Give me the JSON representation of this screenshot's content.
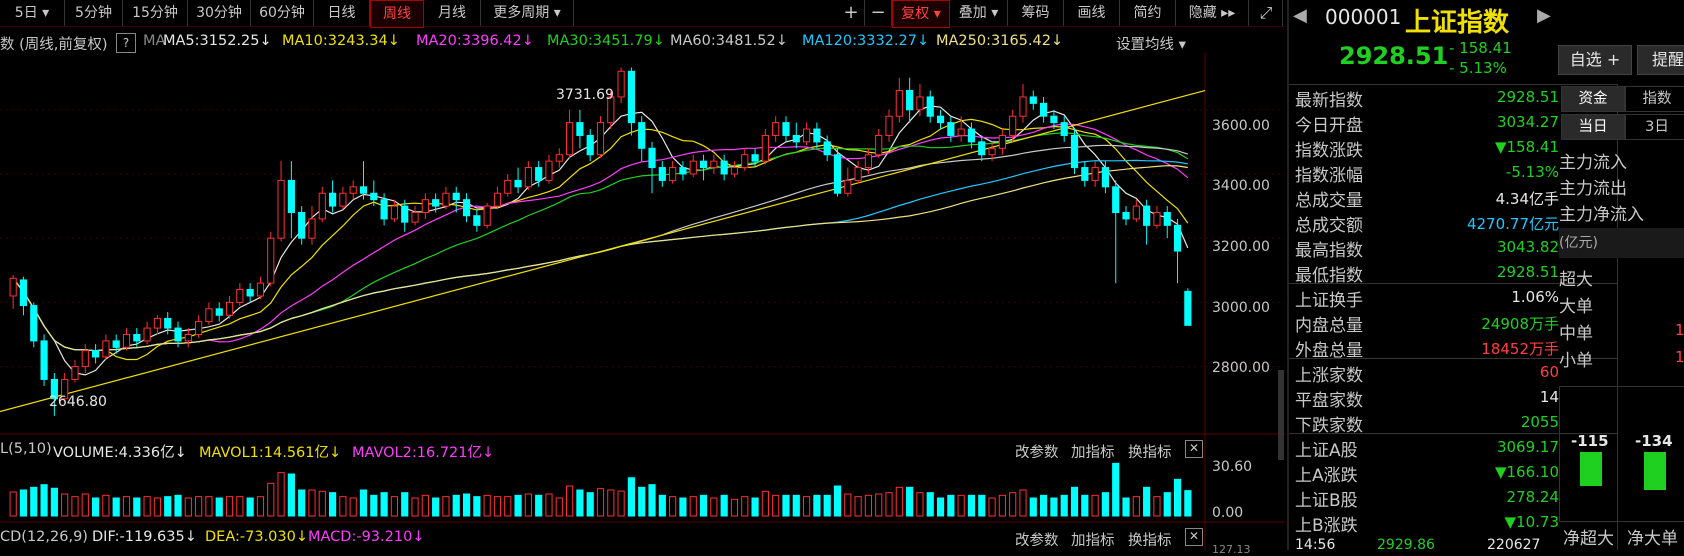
{
  "toolbar": {
    "periods": [
      "5日",
      "5分钟",
      "15分钟",
      "30分钟",
      "60分钟",
      "日线",
      "周线",
      "月线",
      "更多周期"
    ],
    "active_period": "周线",
    "right_buttons": [
      "+",
      "−",
      "复权",
      "叠加",
      "筹码",
      "画线",
      "简约",
      "隐藏"
    ]
  },
  "ma_legend": {
    "prefix": "数 (周线,前复权)",
    "help": "?",
    "ma_label": "MA",
    "items": [
      {
        "text": "MA5:3152.25",
        "color": "#e6e6e6"
      },
      {
        "text": "MA10:3243.34",
        "color": "#f0e000"
      },
      {
        "text": "MA20:3396.42",
        "color": "#ff3cff"
      },
      {
        "text": "MA30:3451.79",
        "color": "#20d020"
      },
      {
        "text": "MA60:3481.52",
        "color": "#c8c8c8"
      },
      {
        "text": "MA120:3332.27",
        "color": "#20c8ff"
      },
      {
        "text": "MA250:3165.42",
        "color": "#f0e080"
      }
    ],
    "settings": "设置均线"
  },
  "price_axis": [
    "3600.00",
    "3400.00",
    "3200.00",
    "3000.00",
    "2800.00"
  ],
  "annotations": {
    "high": "3731.69",
    "low": "2646.80"
  },
  "volume_header": {
    "prefix": "L(5,10)",
    "volume": "VOLUME:4.336亿",
    "mavol1": "MAVOL1:14.561亿",
    "mavol2": "MAVOL2:16.721亿",
    "buttons": [
      "改参数",
      "加指标",
      "换指标"
    ]
  },
  "volume_axis": [
    "30.60",
    "0.00"
  ],
  "macd_header": {
    "prefix": "CD(12,26,9)",
    "dif": "DIF:-119.635",
    "dea": "DEA:-73.030",
    "macd": "MACD:-93.210",
    "buttons": [
      "改参数",
      "加指标",
      "换指标"
    ],
    "axis_partial": "127.13"
  },
  "quote": {
    "code": "000001",
    "name": "上证指数",
    "price": "2928.51",
    "change": "- 158.41",
    "change_pct": "- 5.13%",
    "watch_button": "自选 +",
    "extra_button": "提醒",
    "rows": [
      {
        "label": "最新指数",
        "value": "2928.51",
        "color": "#20d020"
      },
      {
        "label": "今日开盘",
        "value": "3034.27",
        "color": "#20d020"
      },
      {
        "label": "指数涨跌",
        "value": "▼158.41",
        "color": "#20d020"
      },
      {
        "label": "指数涨幅",
        "value": "-5.13%",
        "color": "#20d020"
      },
      {
        "label": "总成交量",
        "value": "4.34亿手",
        "color": "#e6e6e6"
      },
      {
        "label": "总成交额",
        "value": "4270.77亿元",
        "color": "#20c8ff"
      },
      {
        "label": "最高指数",
        "value": "3043.82",
        "color": "#20d020"
      },
      {
        "label": "最低指数",
        "value": "2928.51",
        "color": "#20d020"
      },
      {
        "label": "上证换手",
        "value": "1.06%",
        "color": "#e6e6e6"
      },
      {
        "label": "内盘总量",
        "value": "24908万手",
        "color": "#20d020"
      },
      {
        "label": "外盘总量",
        "value": "18452万手",
        "color": "#ff4040"
      },
      {
        "label": "上涨家数",
        "value": "60",
        "color": "#ff4040"
      },
      {
        "label": "平盘家数",
        "value": "14",
        "color": "#e6e6e6"
      },
      {
        "label": "下跌家数",
        "value": "2055",
        "color": "#20d020"
      },
      {
        "label": "上证A股",
        "value": "3069.17",
        "color": "#20d020"
      },
      {
        "label": "上A涨跌",
        "value": "▼166.10",
        "color": "#20d020"
      },
      {
        "label": "上证B股",
        "value": "278.24",
        "color": "#20d020"
      },
      {
        "label": "上B涨跌",
        "value": "▼10.73",
        "color": "#20d020"
      }
    ],
    "bottom_row": {
      "time": "14:56",
      "price": "2929.86",
      "vol": "220627"
    }
  },
  "fund_panel": {
    "tabs1": [
      "资金",
      "指数"
    ],
    "tabs2": [
      "当日",
      "3日"
    ],
    "flows": [
      "主力流入",
      "主力流出",
      "主力净流入"
    ],
    "unit": "(亿元)",
    "sizes": [
      {
        "label": "超大",
        "value": ""
      },
      {
        "label": "大单",
        "value": ""
      },
      {
        "label": "中单",
        "value": "1"
      },
      {
        "label": "小单",
        "value": "1"
      }
    ],
    "bars": [
      {
        "label": "净超大",
        "value": "-115"
      },
      {
        "label": "净大单",
        "value": "-134"
      }
    ]
  },
  "chart_data": {
    "type": "candlestick",
    "note_series": [
      "MA5",
      "MA10",
      "MA20",
      "MA30",
      "MA60",
      "MA120",
      "MA250"
    ],
    "last_close": 2928.51,
    "high": 3731.69,
    "low": 2646.8,
    "ylim": [
      2590,
      3780
    ],
    "ticks": [
      3600,
      3400,
      3200,
      3000,
      2800
    ],
    "candles": [
      [
        3020,
        3075,
        2980,
        3085
      ],
      [
        3070,
        2990,
        2960,
        3080
      ],
      [
        2990,
        2880,
        2860,
        3000
      ],
      [
        2880,
        2760,
        2740,
        2900
      ],
      [
        2760,
        2700,
        2646.8,
        2780
      ],
      [
        2700,
        2760,
        2690,
        2780
      ],
      [
        2760,
        2800,
        2750,
        2820
      ],
      [
        2800,
        2850,
        2780,
        2870
      ],
      [
        2850,
        2830,
        2810,
        2870
      ],
      [
        2830,
        2880,
        2820,
        2900
      ],
      [
        2880,
        2860,
        2840,
        2900
      ],
      [
        2860,
        2900,
        2850,
        2920
      ],
      [
        2900,
        2880,
        2860,
        2920
      ],
      [
        2880,
        2920,
        2870,
        2940
      ],
      [
        2920,
        2950,
        2900,
        2960
      ],
      [
        2950,
        2920,
        2900,
        2970
      ],
      [
        2920,
        2880,
        2860,
        2940
      ],
      [
        2880,
        2900,
        2860,
        2920
      ],
      [
        2900,
        2940,
        2890,
        2960
      ],
      [
        2940,
        2980,
        2930,
        3000
      ],
      [
        2980,
        2960,
        2940,
        3000
      ],
      [
        2960,
        3000,
        2950,
        3020
      ],
      [
        3000,
        3040,
        2990,
        3060
      ],
      [
        3040,
        3020,
        3000,
        3060
      ],
      [
        3020,
        3060,
        3010,
        3080
      ],
      [
        3060,
        3200,
        3050,
        3220
      ],
      [
        3200,
        3380,
        3190,
        3440
      ],
      [
        3380,
        3280,
        3200,
        3440
      ],
      [
        3280,
        3200,
        3180,
        3300
      ],
      [
        3200,
        3260,
        3180,
        3300
      ],
      [
        3260,
        3340,
        3250,
        3360
      ],
      [
        3340,
        3300,
        3280,
        3380
      ],
      [
        3300,
        3340,
        3290,
        3360
      ],
      [
        3340,
        3360,
        3320,
        3380
      ],
      [
        3360,
        3340,
        3320,
        3440
      ],
      [
        3340,
        3320,
        3300,
        3380
      ],
      [
        3320,
        3260,
        3240,
        3340
      ],
      [
        3260,
        3300,
        3250,
        3320
      ],
      [
        3300,
        3250,
        3220,
        3320
      ],
      [
        3250,
        3280,
        3240,
        3300
      ],
      [
        3280,
        3320,
        3260,
        3340
      ],
      [
        3320,
        3300,
        3280,
        3340
      ],
      [
        3300,
        3340,
        3290,
        3360
      ],
      [
        3340,
        3320,
        3280,
        3360
      ],
      [
        3320,
        3270,
        3250,
        3340
      ],
      [
        3270,
        3240,
        3220,
        3290
      ],
      [
        3240,
        3300,
        3230,
        3310
      ],
      [
        3300,
        3340,
        3290,
        3360
      ],
      [
        3340,
        3380,
        3330,
        3400
      ],
      [
        3380,
        3360,
        3340,
        3420
      ],
      [
        3360,
        3420,
        3350,
        3440
      ],
      [
        3420,
        3380,
        3360,
        3440
      ],
      [
        3380,
        3440,
        3370,
        3460
      ],
      [
        3440,
        3460,
        3420,
        3480
      ],
      [
        3460,
        3560,
        3450,
        3600
      ],
      [
        3560,
        3520,
        3480,
        3600
      ],
      [
        3520,
        3460,
        3440,
        3540
      ],
      [
        3460,
        3560,
        3450,
        3580
      ],
      [
        3560,
        3640,
        3540,
        3660
      ],
      [
        3640,
        3720,
        3620,
        3731.69
      ],
      [
        3720,
        3560,
        3520,
        3731.69
      ],
      [
        3560,
        3480,
        3440,
        3580
      ],
      [
        3480,
        3420,
        3340,
        3500
      ],
      [
        3420,
        3380,
        3360,
        3440
      ],
      [
        3380,
        3420,
        3370,
        3440
      ],
      [
        3420,
        3400,
        3380,
        3440
      ],
      [
        3400,
        3440,
        3390,
        3460
      ],
      [
        3440,
        3420,
        3380,
        3460
      ],
      [
        3420,
        3440,
        3400,
        3460
      ],
      [
        3440,
        3400,
        3380,
        3460
      ],
      [
        3400,
        3420,
        3390,
        3440
      ],
      [
        3420,
        3460,
        3410,
        3480
      ],
      [
        3460,
        3440,
        3420,
        3480
      ],
      [
        3440,
        3520,
        3430,
        3540
      ],
      [
        3520,
        3560,
        3500,
        3580
      ],
      [
        3560,
        3520,
        3500,
        3580
      ],
      [
        3520,
        3500,
        3480,
        3560
      ],
      [
        3500,
        3540,
        3490,
        3560
      ],
      [
        3540,
        3500,
        3480,
        3560
      ],
      [
        3500,
        3460,
        3440,
        3520
      ],
      [
        3460,
        3340,
        3330,
        3480
      ],
      [
        3340,
        3380,
        3330,
        3420
      ],
      [
        3380,
        3420,
        3370,
        3440
      ],
      [
        3420,
        3460,
        3400,
        3480
      ],
      [
        3460,
        3520,
        3450,
        3540
      ],
      [
        3520,
        3580,
        3500,
        3600
      ],
      [
        3580,
        3660,
        3560,
        3700
      ],
      [
        3660,
        3600,
        3560,
        3700
      ],
      [
        3600,
        3640,
        3580,
        3680
      ],
      [
        3640,
        3580,
        3560,
        3660
      ],
      [
        3580,
        3560,
        3540,
        3600
      ],
      [
        3560,
        3520,
        3500,
        3580
      ],
      [
        3520,
        3540,
        3500,
        3580
      ],
      [
        3540,
        3500,
        3480,
        3560
      ],
      [
        3500,
        3460,
        3440,
        3520
      ],
      [
        3460,
        3480,
        3440,
        3500
      ],
      [
        3480,
        3520,
        3460,
        3540
      ],
      [
        3520,
        3580,
        3500,
        3600
      ],
      [
        3580,
        3640,
        3560,
        3680
      ],
      [
        3640,
        3620,
        3600,
        3660
      ],
      [
        3620,
        3580,
        3560,
        3640
      ],
      [
        3580,
        3560,
        3540,
        3600
      ],
      [
        3560,
        3520,
        3500,
        3580
      ],
      [
        3520,
        3420,
        3400,
        3540
      ],
      [
        3420,
        3380,
        3360,
        3440
      ],
      [
        3380,
        3420,
        3360,
        3440
      ],
      [
        3420,
        3360,
        3340,
        3440
      ],
      [
        3360,
        3280,
        3060,
        3380
      ],
      [
        3280,
        3260,
        3240,
        3300
      ],
      [
        3260,
        3300,
        3250,
        3320
      ],
      [
        3300,
        3240,
        3180,
        3320
      ],
      [
        3240,
        3280,
        3230,
        3300
      ],
      [
        3280,
        3240,
        3200,
        3300
      ],
      [
        3240,
        3160,
        3060,
        3260
      ],
      [
        3034.27,
        2928.51,
        2928.51,
        3043.82
      ]
    ]
  }
}
